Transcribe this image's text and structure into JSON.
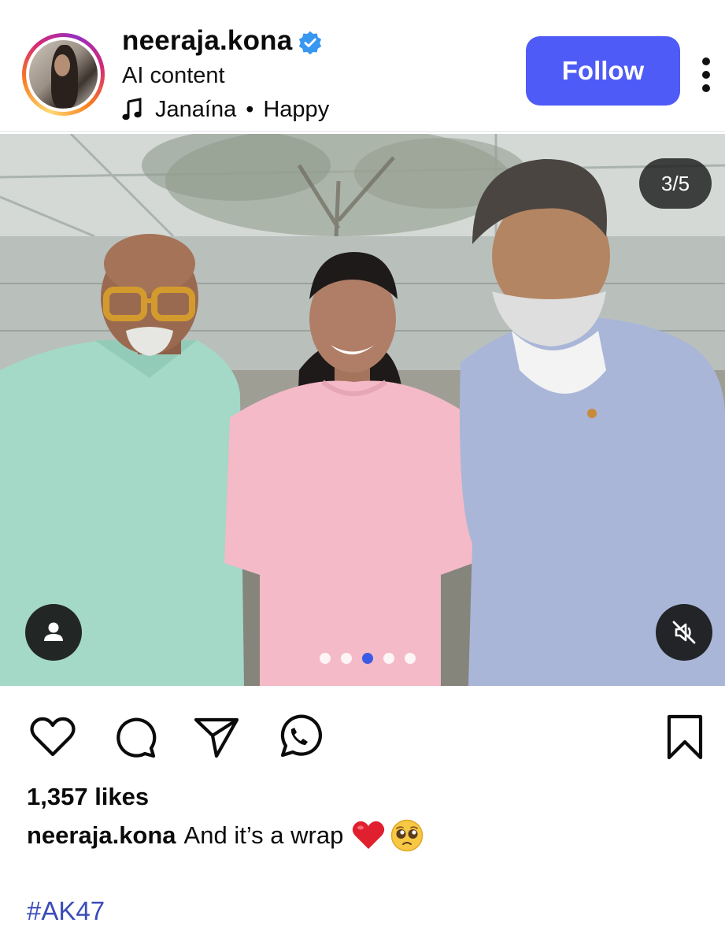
{
  "header": {
    "username": "neeraja.kona",
    "verified": true,
    "subtitle": "AI content",
    "music": {
      "artist": "Janaína",
      "separator": "•",
      "track": "Happy"
    },
    "follow_label": "Follow",
    "more_icon": "more-vertical-icon"
  },
  "media": {
    "counter": "3/5",
    "carousel_total": 5,
    "carousel_active_index": 2,
    "user_tag_icon": "person-icon",
    "mute_icon": "muted-speaker-icon"
  },
  "actions": {
    "icons": [
      "heart-icon",
      "comment-icon",
      "share-icon",
      "whatsapp-icon",
      "bookmark-icon"
    ]
  },
  "likes_text": "1,357 likes",
  "caption": {
    "username": "neeraja.kona",
    "text": "And it’s a wrap",
    "emojis": [
      "red-heart",
      "pleading-face"
    ]
  },
  "hashtag": "#AK47",
  "colors": {
    "follow_button": "#4f5bf6",
    "verified_badge": "#3897f0",
    "hashtag": "#3b4cb8",
    "active_dot": "#3a5be6"
  }
}
